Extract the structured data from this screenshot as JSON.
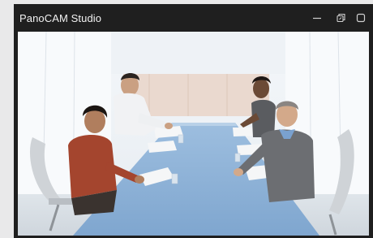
{
  "window": {
    "title": "PanoCAM Studio"
  },
  "controls": {
    "minimize_icon": "minimize-icon",
    "restore_icon": "restore-icon",
    "close_icon": "close-icon"
  },
  "video": {
    "scene": "conference-room"
  },
  "colors": {
    "titlebar": "#1f1f1f",
    "title_text": "#f2f2f2",
    "table": "#8fb2d6"
  }
}
